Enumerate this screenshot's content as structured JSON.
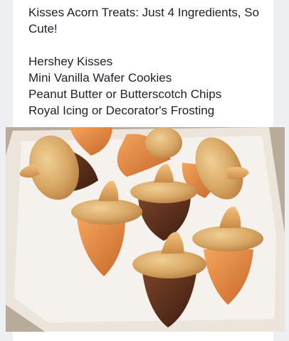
{
  "post": {
    "title": "Kisses Acorn Treats: Just 4 Ingredients, So Cute!",
    "ingredients": [
      "Hershey Kisses",
      "Mini Vanilla Wafer Cookies",
      "Peanut Butter or Butterscotch Chips",
      "Royal Icing or Decorator's Frosting"
    ]
  },
  "photo": {
    "subject": "acorn-treats-photo",
    "colors": {
      "countertop": "#b9ab9c",
      "tray": "#efe9e1",
      "wafer": "#d9a966",
      "kiss_chocolate": "#5a2f1e",
      "kiss_orange": "#e28a3f"
    }
  }
}
